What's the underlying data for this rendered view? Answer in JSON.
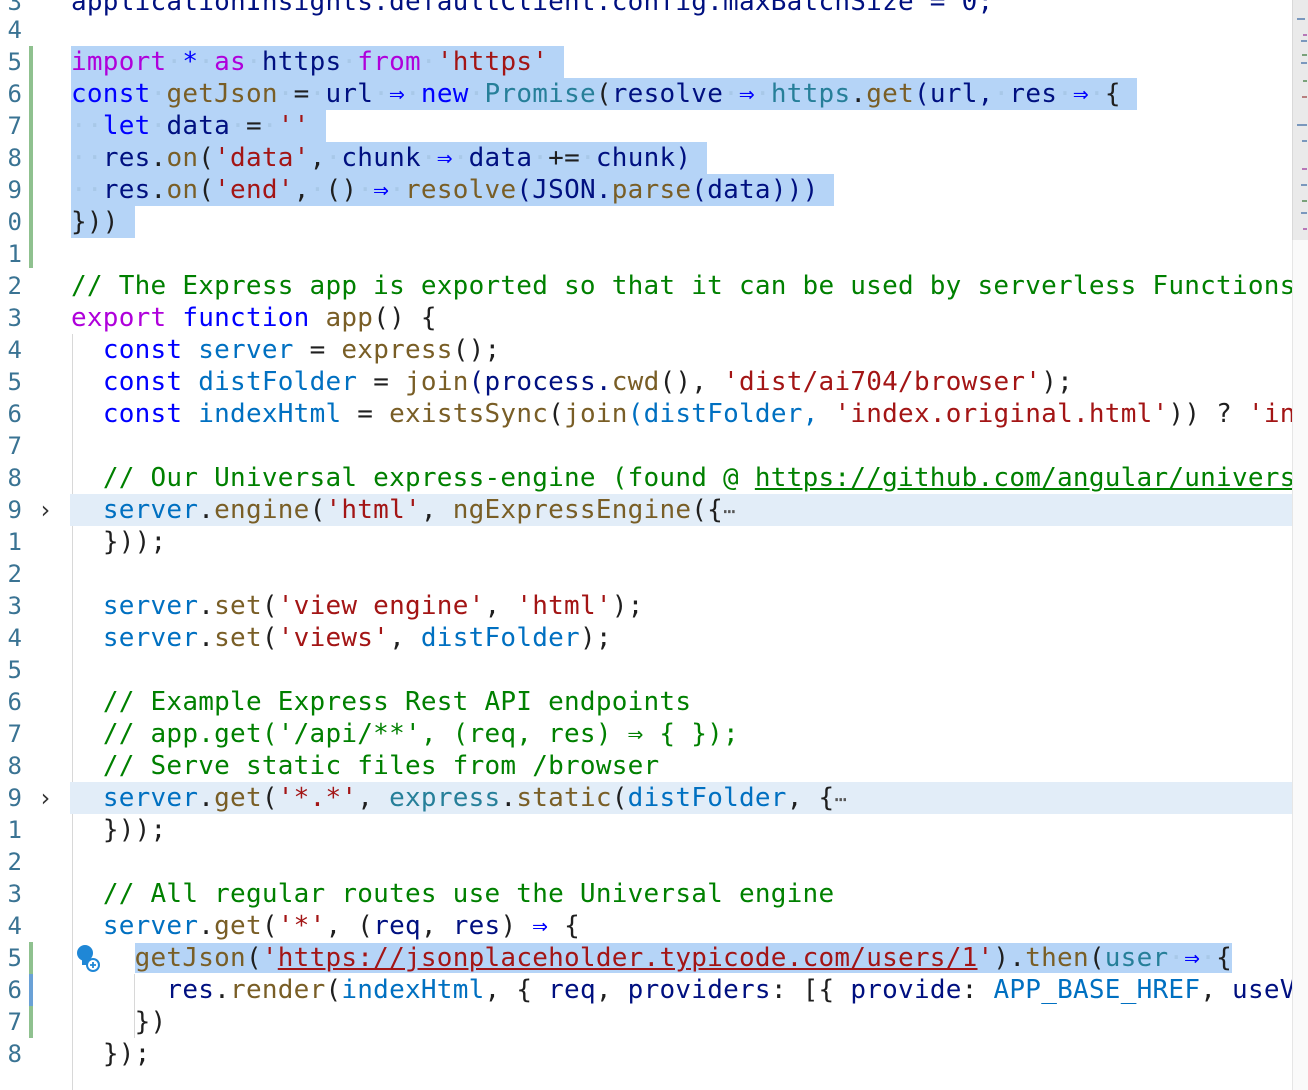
{
  "editor": {
    "line_numbers": [
      "3",
      "4",
      "5",
      "6",
      "7",
      "8",
      "9",
      "0",
      "1",
      "2",
      "3",
      "4",
      "5",
      "6",
      "7",
      "8",
      "9",
      "1",
      "2",
      "3",
      "4",
      "5",
      "6",
      "7",
      "8",
      "9",
      "1",
      "2",
      "3",
      "4",
      "5",
      "6",
      "7",
      "8"
    ],
    "top_partial_line": "applicationInsights.defaultClient.config.maxBatchSize = 0;",
    "lines": {
      "l5": {
        "t1": "import",
        "t2": "*",
        "t3": "as",
        "t4": "https",
        "t5": "from",
        "t6": "'https'"
      },
      "l6": {
        "t1": "const",
        "t2": "getJson",
        "t3": "=",
        "t4": "url",
        "t5": "⇒",
        "t6": "new",
        "t7": "Promise",
        "t8": "(",
        "t9": "resolve",
        "t10": "⇒",
        "t11": "https",
        "t12": ".",
        "t13": "get",
        "t14": "(url,",
        "t15": "res",
        "t16": "⇒",
        "t17": "{"
      },
      "l7": {
        "t1": "let",
        "t2": "data",
        "t3": "=",
        "t4": "''"
      },
      "l8": {
        "t1": "res",
        "t2": ".",
        "t3": "on",
        "t4": "(",
        "t5": "'data'",
        "t6": ",",
        "t7": "chunk",
        "t8": "⇒",
        "t9": "data",
        "t10": "+=",
        "t11": "chunk)"
      },
      "l9": {
        "t1": "res",
        "t2": ".",
        "t3": "on",
        "t4": "(",
        "t5": "'end'",
        "t6": ",",
        "t7": "()",
        "t8": "⇒",
        "t9": "resolve",
        "t10": "(JSON.",
        "t11": "parse",
        "t12": "(data)))"
      },
      "l10": {
        "t1": "}))"
      },
      "l12": {
        "t1": "// The Express app is exported so that it can be used by serverless Functions."
      },
      "l13": {
        "t1": "export",
        "t2": "function",
        "t3": "app",
        "t4": "() {"
      },
      "l14": {
        "t1": "const",
        "t2": "server",
        "t3": "=",
        "t4": "express",
        "t5": "();"
      },
      "l15": {
        "t1": "const",
        "t2": "distFolder",
        "t3": "=",
        "t4": "join",
        "t5": "(process.",
        "t6": "cwd",
        "t7": "(), ",
        "t8": "'dist/ai704/browser'",
        "t9": ");"
      },
      "l16": {
        "t1": "const",
        "t2": "indexHtml",
        "t3": "=",
        "t4": "existsSync",
        "t5": "(",
        "t6": "join",
        "t7": "(distFolder, ",
        "t8": "'index.original.html'",
        "t9": ")) ? ",
        "t10": "'inde"
      },
      "l18": {
        "t1": "// Our Universal express-engine (found @ ",
        "t2": "https://github.com/angular/universal"
      },
      "l19": {
        "t1": "server",
        "t2": ".",
        "t3": "engine",
        "t4": "(",
        "t5": "'html'",
        "t6": ", ",
        "t7": "ngExpressEngine",
        "t8": "({",
        "t9": "⋯"
      },
      "l20": {
        "t1": "}));"
      },
      "l22": {
        "t1": "server",
        "t2": ".",
        "t3": "set",
        "t4": "(",
        "t5": "'view engine'",
        "t6": ", ",
        "t7": "'html'",
        "t8": ");"
      },
      "l23": {
        "t1": "server",
        "t2": ".",
        "t3": "set",
        "t4": "(",
        "t5": "'views'",
        "t6": ", ",
        "t7": "distFolder",
        "t8": ");"
      },
      "l25": {
        "t1": "// Example Express Rest API endpoints"
      },
      "l26": {
        "t1": "// app.get('/api/**', (req, res) ⇒ { });"
      },
      "l27": {
        "t1": "// Serve static files from /browser"
      },
      "l28": {
        "t1": "server",
        "t2": ".",
        "t3": "get",
        "t4": "(",
        "t5": "'*.*'",
        "t6": ", ",
        "t7": "express",
        "t8": ".",
        "t9": "static",
        "t10": "(",
        "t11": "distFolder",
        "t12": ", {",
        "t13": "⋯"
      },
      "l29": {
        "t1": "}));"
      },
      "l31": {
        "t1": "// All regular routes use the Universal engine"
      },
      "l32": {
        "t1": "server",
        "t2": ".",
        "t3": "get",
        "t4": "(",
        "t5": "'*'",
        "t6": ", (",
        "t7": "req",
        "t8": ", ",
        "t9": "res",
        "t10": ") ",
        "t11": "⇒",
        "t12": " {"
      },
      "l33": {
        "t1": "getJson",
        "t2": "(",
        "t3": "'",
        "t4": "https://jsonplaceholder.typicode.com/users/1",
        "t5": "'",
        ".": ".",
        "t6": ").",
        "t7": "then",
        "t8": "(",
        "t9": "user",
        "t10": "⇒",
        "t11": "{"
      },
      "l34": {
        "t1": "res",
        "t2": ".",
        "t3": "render",
        "t4": "(",
        "t5": "indexHtml",
        "t6": ", { ",
        "t7": "req",
        "t8": ", ",
        "t9": "providers",
        "t10": ": [{ ",
        "t11": "provide",
        "t12": ": ",
        "t13": "APP_BASE_HREF",
        "t14": ", ",
        "t15": "useVa"
      },
      "l35": {
        "t1": "})"
      },
      "l36": {
        "t1": "});"
      }
    }
  },
  "icons": {
    "fold_chevron": "›",
    "lightbulb": "lightbulb-icon"
  },
  "colors": {
    "selection": "#b5d4f7",
    "keyword": "#0000ff",
    "control": "#af00db",
    "string": "#a31515",
    "comment": "#008000",
    "function": "#795e26"
  }
}
